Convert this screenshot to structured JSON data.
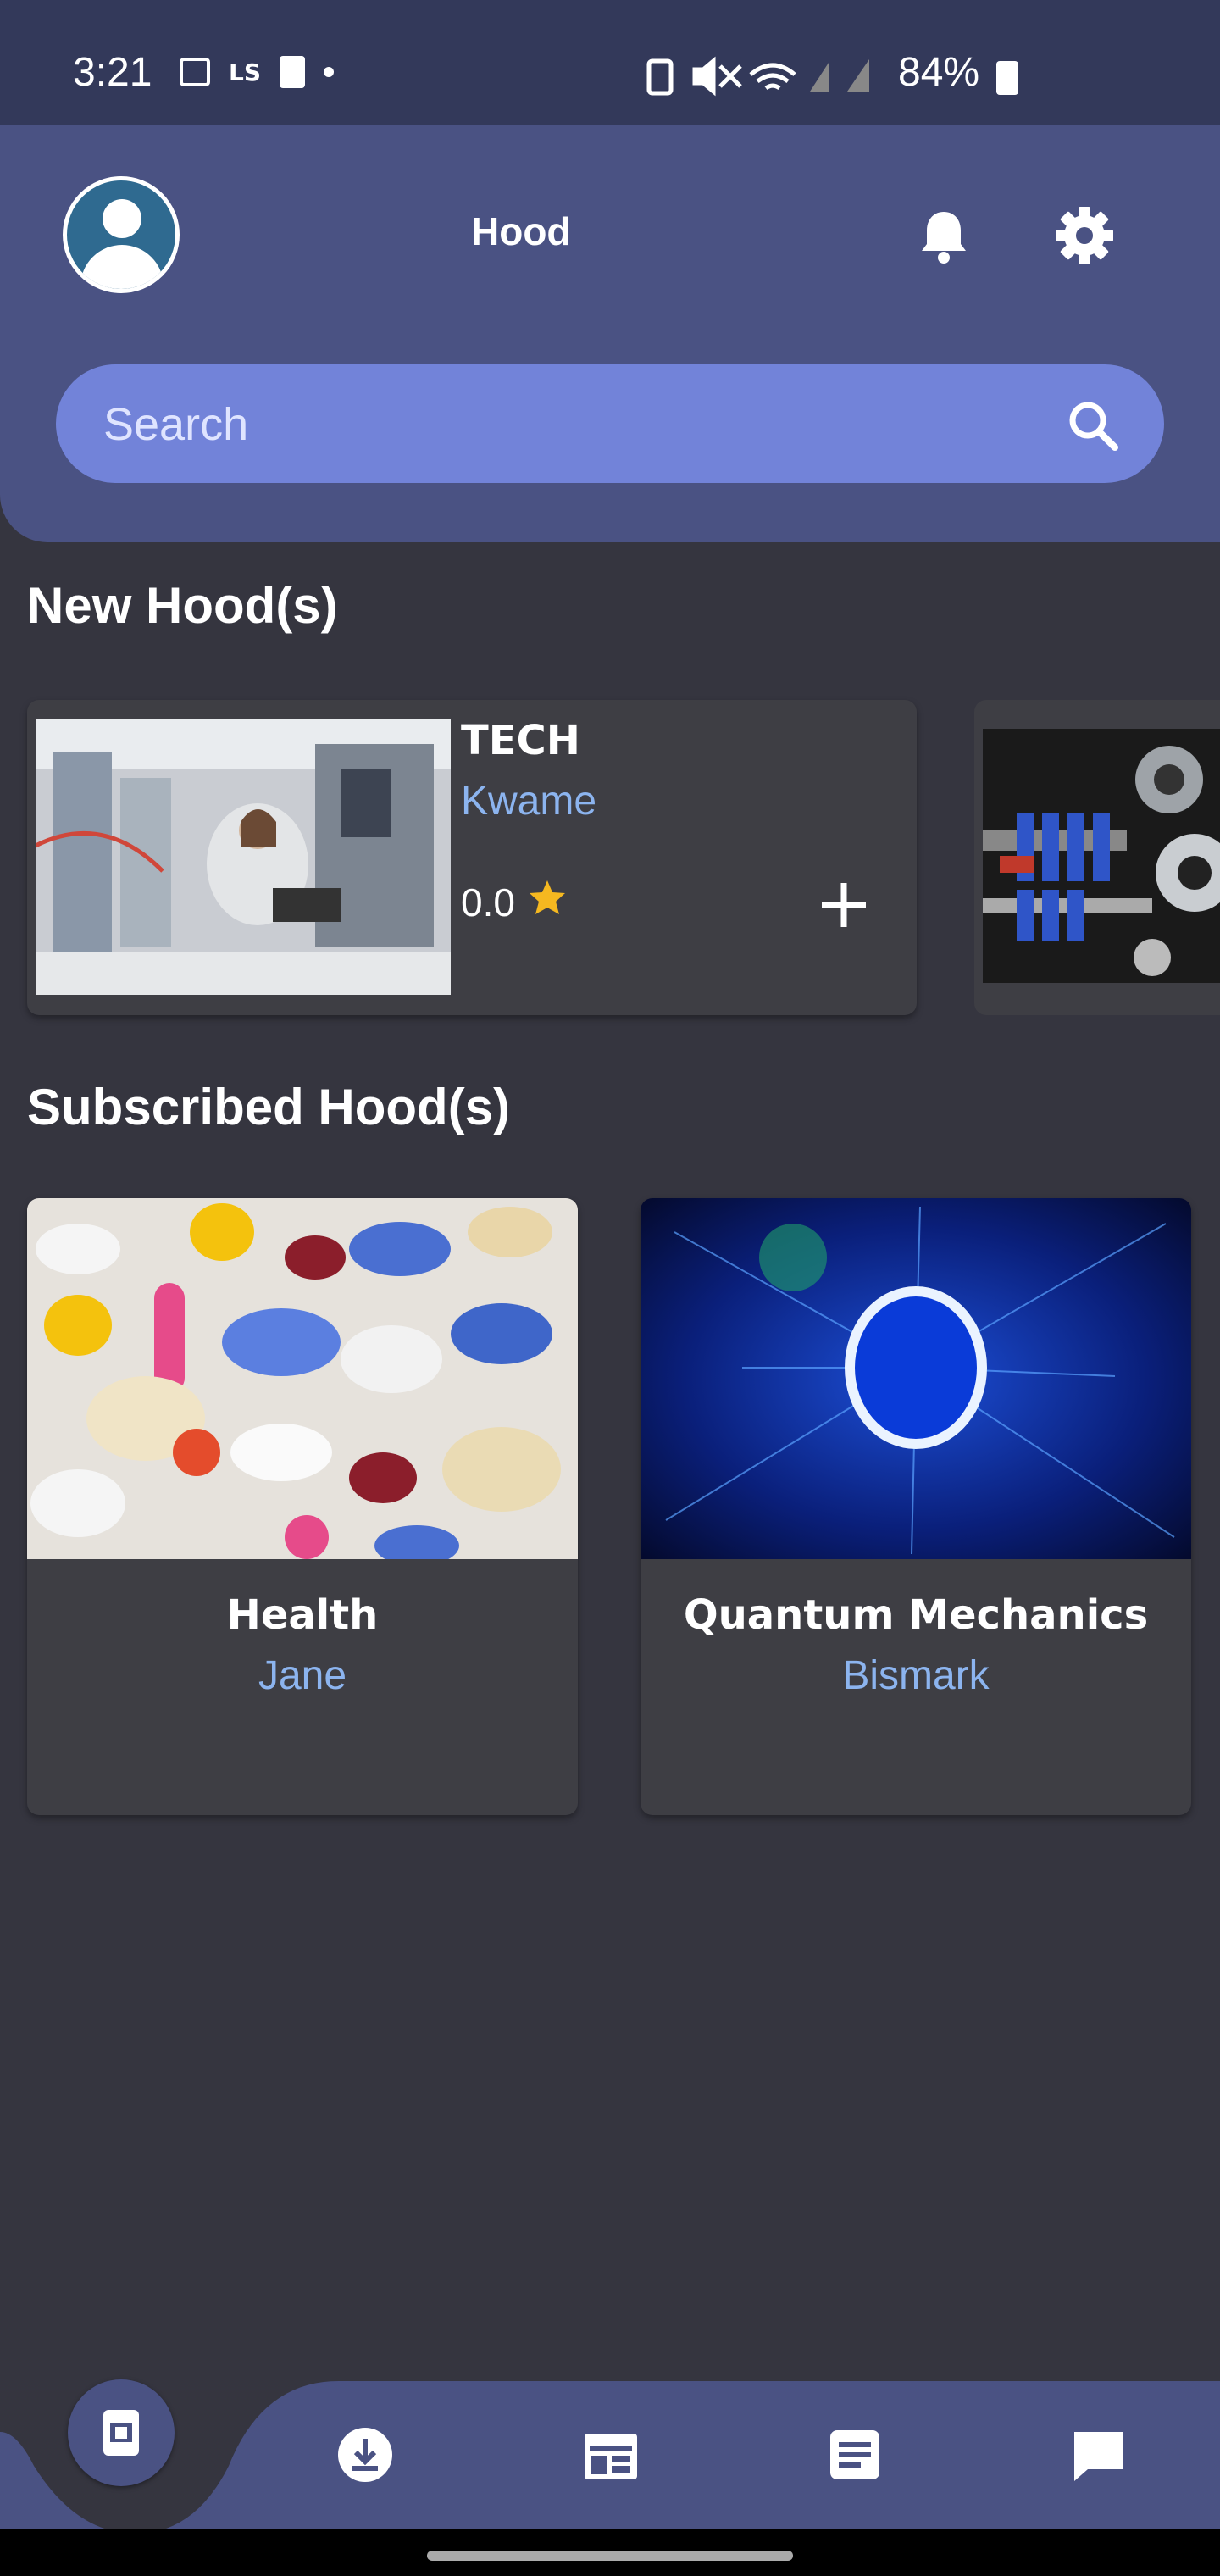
{
  "status_bar": {
    "time": "3:21",
    "carrier_glyph": "LS",
    "battery": "84%"
  },
  "header": {
    "title": "Hood",
    "search_placeholder": "Search"
  },
  "new_hoods": {
    "heading": "New Hood(s)",
    "items": [
      {
        "title": "TECH",
        "author": "Kwame",
        "rating": "0.0",
        "image": "engineer-lab-photo"
      },
      {
        "title": "",
        "author": "",
        "rating": "",
        "image": "engine-parts-photo"
      }
    ]
  },
  "subscribed_hoods": {
    "heading": "Subscribed Hood(s)",
    "items": [
      {
        "title": "Health",
        "author": "Jane",
        "image": "pills-photo"
      },
      {
        "title": "Quantum Mechanics",
        "author": "Bismark",
        "image": "blue-energy-ring-photo"
      }
    ]
  },
  "bottom_nav": {
    "items": [
      "home-icon",
      "download-icon",
      "calendar-icon",
      "notes-icon",
      "chat-icon"
    ]
  },
  "colors": {
    "background": "#35353f",
    "header": "#4a5283",
    "search": "#7283d9",
    "author_link": "#8cb4ef",
    "star": "#f5b820"
  }
}
